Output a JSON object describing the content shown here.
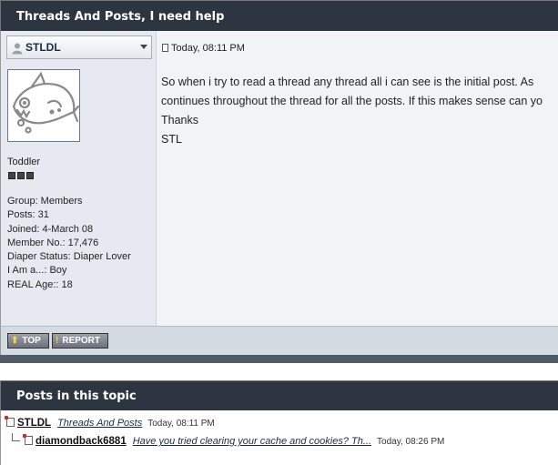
{
  "post_header": {
    "title": "Threads And Posts, I need help"
  },
  "author": {
    "name": "STLDL",
    "rank": "Toddler",
    "pip_count": 3,
    "info": [
      "Group: Members",
      "Posts: 31",
      "Joined: 4-March 08",
      "Member No.: 17,476",
      "Diaper Status: Diaper Lover",
      "I Am a...: Boy",
      "REAL Age:: 18"
    ]
  },
  "post": {
    "date": "Today, 08:11 PM",
    "lines": [
      "So when i try to read a thread any thread all i can see is the initial post. As",
      "continues throughout the thread for all the posts. If this makes sense can yo",
      "Thanks",
      "STL"
    ]
  },
  "buttons": {
    "top": "TOP",
    "report": "REPORT"
  },
  "topic_header": {
    "title": "Posts in this topic"
  },
  "topic_posts": [
    {
      "user": "STLDL",
      "title": "Threads And Posts",
      "date": "Today, 08:11 PM"
    },
    {
      "user": "diamondback6881",
      "title": "Have you tried clearing your cache and cookies? Th...",
      "date": "Today, 08:26 PM"
    }
  ],
  "colors": {
    "header_bg": "#2d3541",
    "sidebar_bg": "#e6eaf0",
    "post_bg": "#f1f3f6"
  }
}
